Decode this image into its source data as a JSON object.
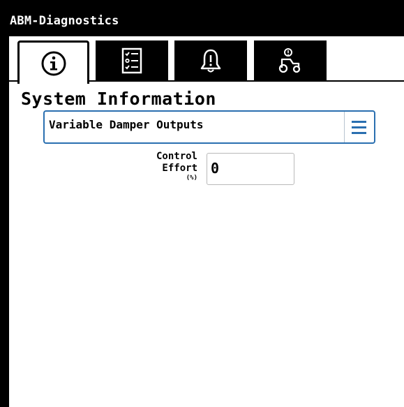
{
  "app": {
    "title": "ABM-Diagnostics"
  },
  "tabs": [
    {
      "icon": "info-icon",
      "active": true
    },
    {
      "icon": "checklist-icon",
      "active": false
    },
    {
      "icon": "bell-icon",
      "active": false
    },
    {
      "icon": "tractor-icon",
      "active": false
    }
  ],
  "page": {
    "title": "System Information"
  },
  "selector": {
    "value": "Variable Damper Outputs",
    "menu_icon": "hamburger-menu-icon"
  },
  "field": {
    "label_line1": "Control",
    "label_line2": "Effort",
    "unit": "(%)",
    "value": "0"
  },
  "colors": {
    "accent": "#2a6fb0",
    "chrome": "#000000",
    "background": "#ffffff"
  }
}
